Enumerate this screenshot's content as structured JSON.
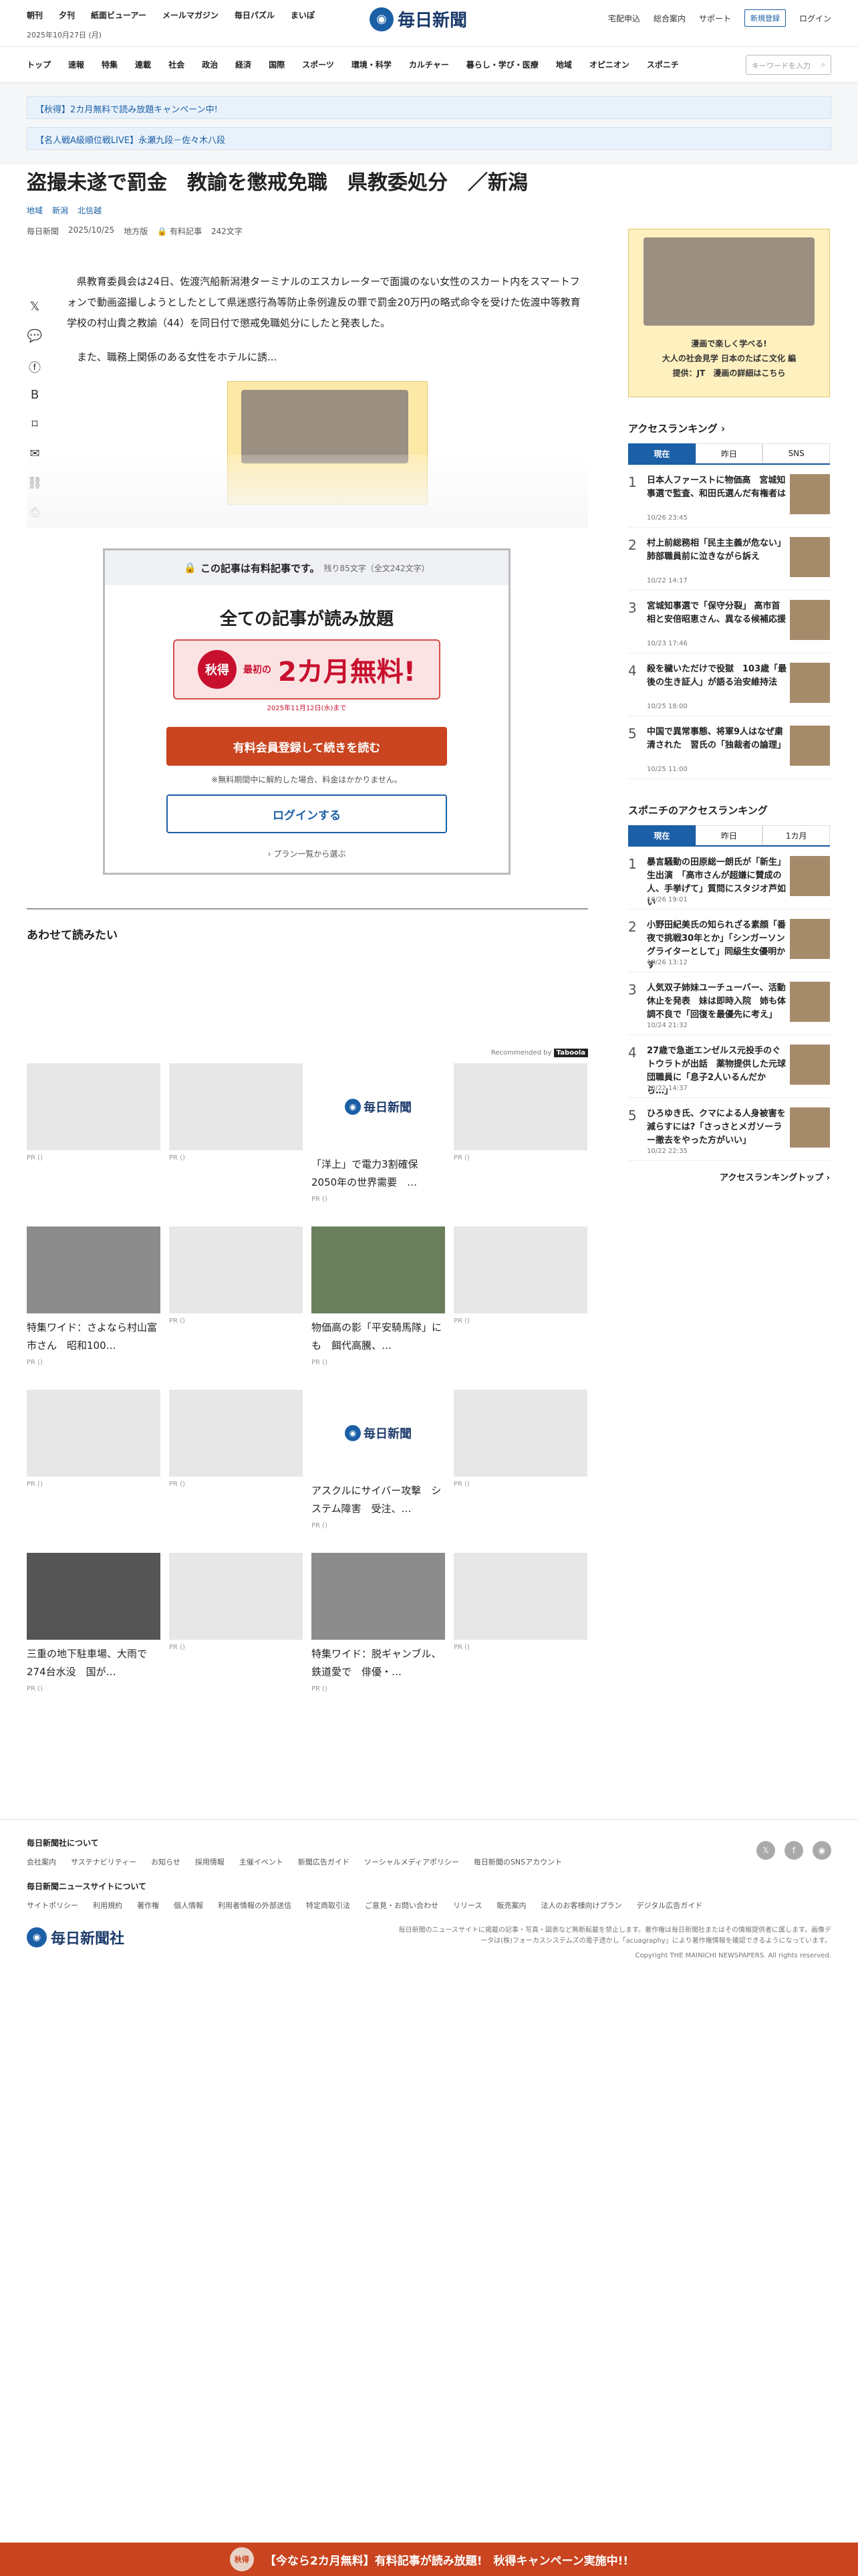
{
  "header": {
    "links": [
      "朝刊",
      "夕刊",
      "紙面ビューアー",
      "メールマガジン",
      "毎日パズル",
      "まいぽ"
    ],
    "date": "2025年10月27日 (月)",
    "brand": "毎日新聞",
    "right": [
      "宅配申込",
      "総合案内",
      "サポート"
    ],
    "register": "新規登録",
    "login": "ログイン"
  },
  "nav": {
    "items": [
      "トップ",
      "速報",
      "特集",
      "連載",
      "社会",
      "政治",
      "経済",
      "国際",
      "スポーツ",
      "環境・科学",
      "カルチャー",
      "暮らし・学び・医療",
      "地域",
      "オピニオン",
      "スポニチ"
    ],
    "search_placeholder": "キーワードを入力"
  },
  "promos": [
    "【秋得】2カ月無料で読み放題キャンペーン中!",
    "【名人戦A級順位戦LIVE】永瀬九段－佐々木八段"
  ],
  "article": {
    "title": "盗撮未遂で罰金　教諭を懲戒免職　県教委処分　／新潟",
    "crumbs": [
      "地域",
      "新潟",
      "北信越"
    ],
    "source": "毎日新聞",
    "date": "2025/10/25",
    "edition": "地方版",
    "paid_label": "有料記事",
    "chars": "242文字",
    "p1": "県教育委員会は24日、佐渡汽船新潟港ターミナルのエスカレーターで面識のない女性のスカート内をスマートフォンで動画盗撮しようとしたとして県迷惑行為等防止条例違反の罪で罰金20万円の略式命令を受けた佐渡中等教育学校の村山貴之教諭（44）を同日付で懲戒免職処分にしたと発表した。",
    "p2": "また、職務上関係のある女性をホテルに誘..."
  },
  "paywall": {
    "head": "この記事は有料記事です。",
    "remain": "残り85文字（全文242文字）",
    "title": "全ての記事が読み放題",
    "badge_small": "秋得",
    "badge_pre": "最初の",
    "badge_big": "2カ月無料!",
    "badge_date": "2025年11月12日(水)まで",
    "cta": "有料会員登録して続きを読む",
    "note": "※無料期間中に解約した場合、料金はかかりません。",
    "login": "ログインする",
    "plans": "プラン一覧から選ぶ"
  },
  "related": {
    "heading": "あわせて読みたい",
    "recommended": "Recommended by",
    "taboola": "Taboola",
    "pr": "PR ()",
    "cards": [
      {
        "title": "",
        "kind": "blank"
      },
      {
        "title": "",
        "kind": "blank"
      },
      {
        "title": "「洋上」で電力3割確保 2050年の世界需要　…",
        "kind": "logo"
      },
      {
        "title": "",
        "kind": "blank"
      },
      {
        "title": "特集ワイド：さよなら村山富市さん　昭和100…",
        "kind": "photo"
      },
      {
        "title": "",
        "kind": "blank"
      },
      {
        "title": "物価高の影「平安騎馬隊」にも　餌代高騰、…",
        "kind": "photo-green"
      },
      {
        "title": "",
        "kind": "blank"
      },
      {
        "title": "",
        "kind": "blank"
      },
      {
        "title": "",
        "kind": "blank"
      },
      {
        "title": "アスクルにサイバー攻撃　システム障害　受注、…",
        "kind": "logo"
      },
      {
        "title": "",
        "kind": "blank"
      },
      {
        "title": "三重の地下駐車場、大雨で274台水没　国が…",
        "kind": "photo-dark"
      },
      {
        "title": "",
        "kind": "blank"
      },
      {
        "title": "特集ワイド：脱ギャンブル、鉄道愛で　俳優・…",
        "kind": "photo"
      },
      {
        "title": "",
        "kind": "blank"
      }
    ]
  },
  "sidebar": {
    "ad_caption1": "漫画で楽しく学べる!",
    "ad_caption2": "大人の社会見学 日本のたばこ文化 編",
    "ad_caption3": "提供：JT　漫画の詳細はこちら",
    "ranking_title": "アクセスランキング",
    "tabs": [
      "現在",
      "昨日",
      "SNS"
    ],
    "items": [
      {
        "n": "1",
        "t": "日本人ファーストに物価高　宮城知事選で監査、和田氏選んだ有権者は",
        "tm": "10/26 23:45"
      },
      {
        "n": "2",
        "t": "村上前総務相「民主主義が危ない」　肺部職員前に泣きながら訴え",
        "tm": "10/22 14:17"
      },
      {
        "n": "3",
        "t": "宮城知事選で「保守分裂」 高市首相と安倍昭恵さん、異なる候補応援",
        "tm": "10/23 17:46"
      },
      {
        "n": "4",
        "t": "殺を穢いただけで役獄　103歳「最後の生き証人」が語る治安維持法",
        "tm": "10/25 18:00"
      },
      {
        "n": "5",
        "t": "中国で異常事態、将軍9人はなぜ粛清された　習氏の「独裁者の論理」",
        "tm": "10/25 11:00"
      }
    ],
    "sponichi_title": "スポニチのアクセスランキング",
    "sponichi_tabs": [
      "現在",
      "昨日",
      "1カ月"
    ],
    "sponichi_items": [
      {
        "n": "1",
        "t": "暴言騒動の田原総一朗氏が「新生」生出演　「高市さんが超嫌に賛成の人、手挙げて」質問にスタジオ芦如い",
        "tm": "10/26 19:01"
      },
      {
        "n": "2",
        "t": "小野田紀美氏の知られざる素顔「番夜で挑戦30年とか」「シンガーソングライターとして」同級生女優明かす",
        "tm": "10/26 13:12"
      },
      {
        "n": "3",
        "t": "人気双子姉妹ユーチューバー、活動休止を発表　妹は即時入院　姉も体調不良で「回復を最優先に考え」",
        "tm": "10/24 21:32"
      },
      {
        "n": "4",
        "t": "27歳で急逝エンゼルス元投手のぐトウラトが出話　薬物提供した元球団職員に「息子2人いるんだから…」",
        "tm": "10/22 14:37"
      },
      {
        "n": "5",
        "t": "ひろゆき氏、クマによる人身被害を減らすには?「さっさとメガソーラー撤去をやった方がいい」",
        "tm": "10/22 22:35"
      }
    ],
    "ranking_more": "アクセスランキングトップ"
  },
  "footer": {
    "h1": "毎日新聞社について",
    "links1": [
      "会社案内",
      "サステナビリティー",
      "お知らせ",
      "採用情報",
      "主催イベント",
      "新聞広告ガイド",
      "ソーシャルメディアポリシー",
      "毎日新聞のSNSアカウント"
    ],
    "h2": "毎日新聞ニュースサイトについて",
    "links2": [
      "サイトポリシー",
      "利用規約",
      "著作権",
      "個人情報",
      "利用者情報の外部送信",
      "特定商取引法",
      "ご意見・お問い合わせ",
      "リリース",
      "販売案内",
      "法人のお客様向けプラン",
      "デジタル広告ガイド"
    ],
    "company": "毎日新聞社",
    "notice": "毎日新聞のニュースサイトに掲載の記事・写真・図表など無断転載を禁止します。著作権は毎日新聞社またはその情報提供者に属します。画像データは(株)フォーカスシステムズの電子透かし「acuagraphy」により著作権情報を確認できるようになっています。",
    "copyright": "Copyright THE MAINICHI NEWSPAPERS. All rights reserved."
  },
  "bottom_bar": {
    "badge": "秋得",
    "text": "【今なら2カ月無料】有料記事が読み放題!　秋得キャンペーン実施中!!"
  }
}
